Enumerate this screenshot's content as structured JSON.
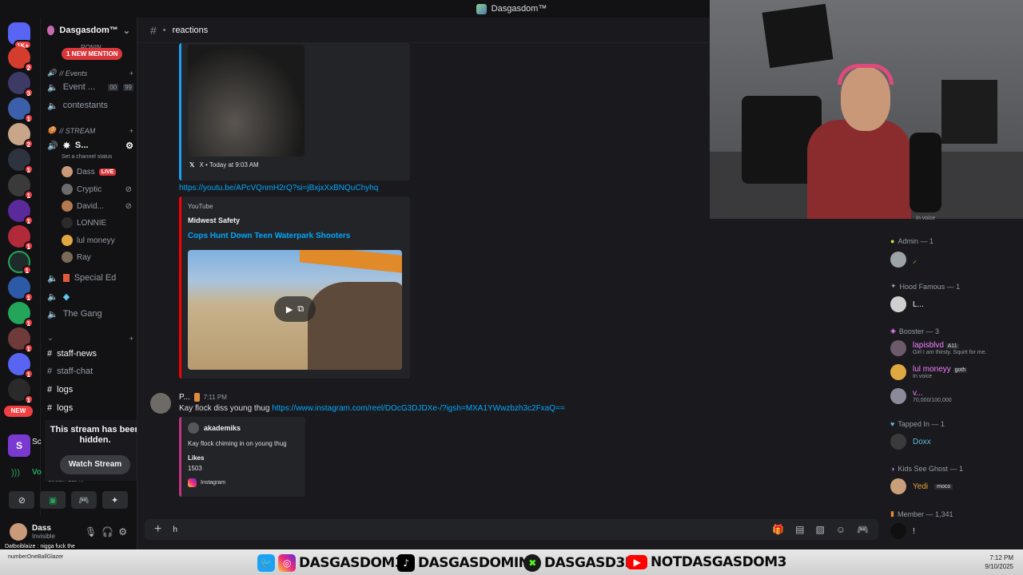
{
  "titlebar": {
    "title": "Dasgasdom™"
  },
  "rail": {
    "badges": [
      "1K+",
      "2",
      "3",
      "1",
      "2",
      "1",
      "1",
      "1",
      "1",
      "1",
      "1",
      "1",
      "1",
      "1",
      "1",
      "1",
      "1",
      "2"
    ],
    "new_label": "NEW"
  },
  "sidebar": {
    "guild_name": "Dasgasdom™",
    "ronin_label": "RONIN",
    "mention_pill": "1 NEW MENTION",
    "events_category": "// Events",
    "event_channel": "Event ...",
    "event_count_a": "00",
    "event_count_b": "99",
    "contestants": "contestants",
    "stream_category": "// STREAM",
    "stream_channel": "S...",
    "channel_status_hint": "Set a channel status",
    "voice_users": [
      {
        "name": "Dass",
        "tag": "LIVE",
        "color": "#c99a7a"
      },
      {
        "name": "Cryptic",
        "tag": "",
        "color": "#6b6b6b"
      },
      {
        "name": "David...",
        "tag": "",
        "color": "#b37a4f"
      },
      {
        "name": "LONNIE",
        "tag": "",
        "color": "#2b2b2b"
      },
      {
        "name": "lul moneyy",
        "tag": "",
        "color": "#e0a840"
      },
      {
        "name": "Ray",
        "tag": "",
        "color": "#7a6a55"
      }
    ],
    "special_ed": "Special Ed",
    "the_gang": "The Gang",
    "text_channels": [
      "staff-news",
      "staff-chat",
      "logs",
      "logs"
    ],
    "stream_hidden_text": "This stream has been hidden.",
    "watch_stream": "Watch Stream",
    "voice_connected_label": "Vo",
    "voice_sub": "Stream Call ...",
    "sc_label": "Sc",
    "user_name": "Dass",
    "user_status": "Invisible"
  },
  "chat": {
    "channel_name": "reactions",
    "embed1_footer": "X • Today at 9:03 AM",
    "youtube_url": "https://youtu.be/APcVQnmH2rQ?si=jBxjxXxBNQuChyhq",
    "yt_provider": "YouTube",
    "yt_author": "Midwest Safety",
    "yt_title": "Cops Hunt Down Teen Waterpark Shooters",
    "msg_author": "P...",
    "msg_time": "7:11 PM",
    "msg_text": "Kay flock diss young thug",
    "msg_link": "https://www.instagram.com/reel/DOcG3DJDXe-/?igsh=MXA1YWwzbzh3c2FxaQ==",
    "ig_author": "akademiks",
    "ig_desc": "Kay flock chiming in on young thug",
    "ig_likes_label": "Likes",
    "ig_likes": "1503",
    "ig_provider": "Instagram",
    "composer_text": "h"
  },
  "members": {
    "in_voice_top": "In voice",
    "groups": [
      {
        "title": "Admin — 1",
        "name": "",
        "name_color": "#dbdee1"
      },
      {
        "title": "Hood Famous — 1",
        "name": "L...",
        "name_color": "#f2f3f5"
      },
      {
        "title": "Booster — 3",
        "name": "",
        "name_color": "#dbdee1"
      },
      {
        "title": "Tapped In — 1",
        "name": "Doxx",
        "name_color": "#5fb8d9"
      },
      {
        "title": "Kids See Ghost — 1",
        "name": "Yedi",
        "name_color": "#e8a23a"
      },
      {
        "title": "Member — 1,341",
        "name": "!",
        "name_color": "#dbdee1"
      }
    ],
    "booster_members": [
      {
        "name": "lapisblvd",
        "tag": "A11",
        "sub": "Girl I am thirsty. Squirt for me.",
        "color": "#f47fff"
      },
      {
        "name": "lul moneyy",
        "tag": "goth",
        "sub": "In voice",
        "color": "#f47fff"
      },
      {
        "name": "v...",
        "tag": "",
        "sub": "70,000/100,000",
        "color": "#f47fff"
      }
    ],
    "yedi_tag": "moco"
  },
  "overlay": {
    "chat_line1": "Datboiblaize : nigga fuck the",
    "chat_line2": "numberOneBallGlazer",
    "handles": [
      "DASGASDOM3",
      "DASGASDOMINI",
      "DASGASD3M",
      "NOTDASGASDOM3"
    ],
    "time": "7:12 PM",
    "date": "9/10/2025"
  },
  "colors": {
    "accent": "#5865f2",
    "live": "#da373c",
    "link": "#00a8fc",
    "booster": "#f47fff"
  }
}
